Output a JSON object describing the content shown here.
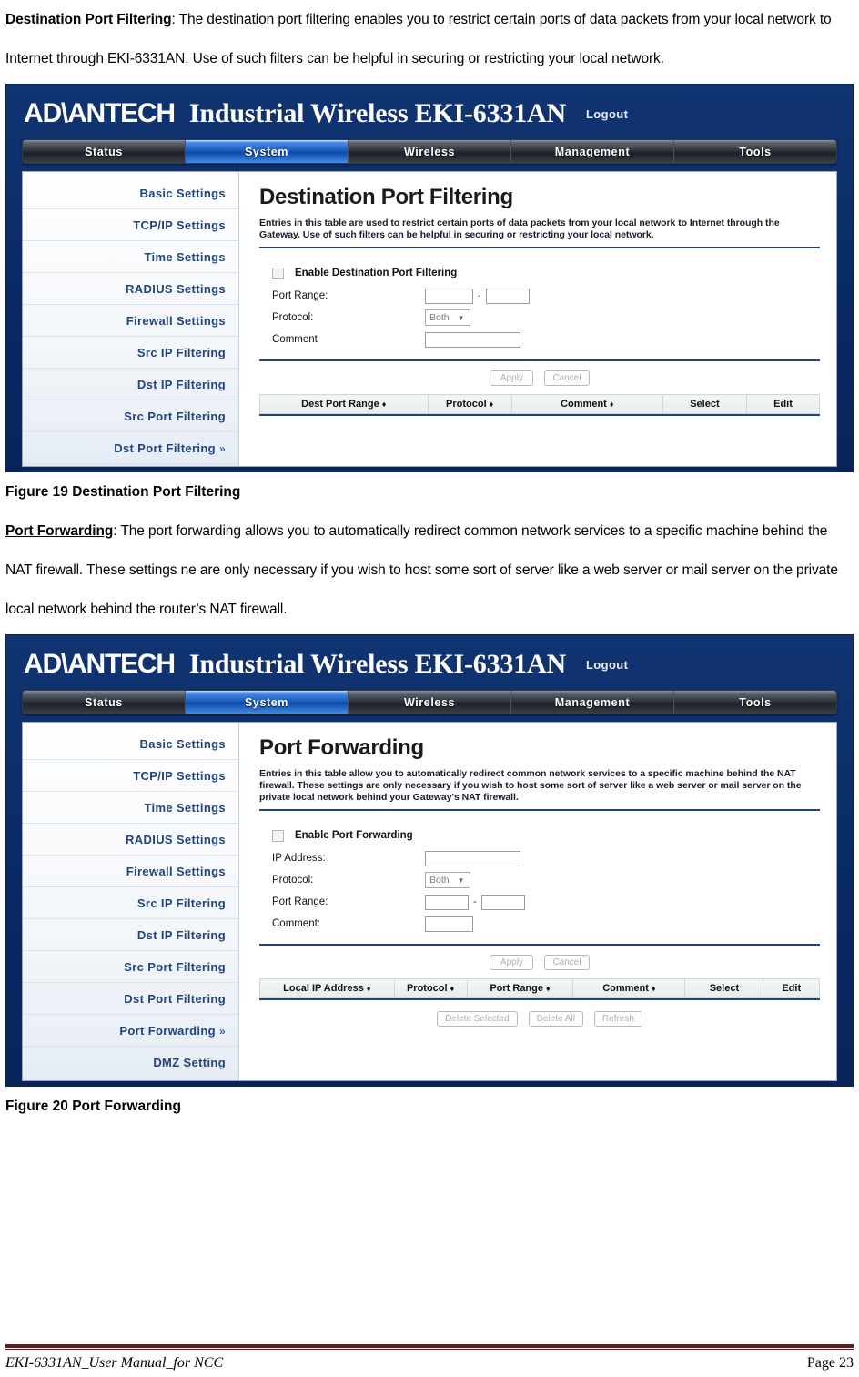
{
  "document": {
    "paragraph_1": {
      "lead": "Destination Port Filtering",
      "body": ": The destination port filtering enables you to restrict certain ports of data packets from your local network to Internet through EKI-6331AN. Use of such filters can be helpful in securing or restricting your local network."
    },
    "figure_19_caption": "Figure 19 Destination Port Filtering",
    "paragraph_2": {
      "lead": "Port Forwarding",
      "body": ": The port forwarding allows you to automatically redirect common network services to a specific machine behind the NAT firewall. These settings ne are only necessary if you wish to host some sort of server like a web server or mail server on the private local network behind the router’s NAT firewall."
    },
    "figure_20_caption": "Figure 20 Port Forwarding",
    "footer": {
      "left": "EKI-6331AN_User Manual_for NCC",
      "right": "Page 23"
    }
  },
  "colors": {
    "shell_blue": "#0d2f6b",
    "accent_blue": "#1456b8",
    "sidebar_text": "#21447f",
    "rule_navy": "#24447c",
    "footer_maroon": "#5c2020"
  },
  "screenshot_1": {
    "brand": {
      "logo": "AD\\ANTECH",
      "title": "Industrial Wireless EKI-6331AN",
      "logout": "Logout"
    },
    "tabs": [
      {
        "label": "Status",
        "active": false
      },
      {
        "label": "System",
        "active": true
      },
      {
        "label": "Wireless",
        "active": false
      },
      {
        "label": "Management",
        "active": false
      },
      {
        "label": "Tools",
        "active": false
      }
    ],
    "sidebar": [
      {
        "label": "Basic Settings",
        "selected": false
      },
      {
        "label": "TCP/IP Settings",
        "selected": false
      },
      {
        "label": "Time Settings",
        "selected": false
      },
      {
        "label": "RADIUS Settings",
        "selected": false
      },
      {
        "label": "Firewall Settings",
        "selected": false
      },
      {
        "label": "Src IP Filtering",
        "selected": false
      },
      {
        "label": "Dst IP Filtering",
        "selected": false
      },
      {
        "label": "Src Port Filtering",
        "selected": false
      },
      {
        "label": "Dst Port Filtering",
        "selected": true
      }
    ],
    "selected_marker": "»",
    "panel": {
      "title": "Destination Port Filtering",
      "description": "Entries in this table are used to restrict certain ports of data packets from your local network to Internet through the Gateway. Use of such filters can be helpful in securing or restricting your local network.",
      "checkbox_label": "Enable Destination Port Filtering",
      "checkbox_checked": false,
      "fields": {
        "port_range_label": "Port Range:",
        "port_range_from": "",
        "port_range_to": "",
        "port_range_separator": "-",
        "protocol_label": "Protocol:",
        "protocol_value": "Both",
        "comment_label": "Comment",
        "comment_value": ""
      },
      "buttons": [
        {
          "label": "Apply"
        },
        {
          "label": "Cancel"
        }
      ],
      "table_headers": [
        {
          "label": "Dest Port Range",
          "sortable": true
        },
        {
          "label": "Protocol",
          "sortable": true
        },
        {
          "label": "Comment",
          "sortable": true
        },
        {
          "label": "Select",
          "sortable": false
        },
        {
          "label": "Edit",
          "sortable": false
        }
      ],
      "sort_icon": "♦"
    }
  },
  "screenshot_2": {
    "brand": {
      "logo": "AD\\ANTECH",
      "title": "Industrial Wireless EKI-6331AN",
      "logout": "Logout"
    },
    "tabs": [
      {
        "label": "Status",
        "active": false
      },
      {
        "label": "System",
        "active": true
      },
      {
        "label": "Wireless",
        "active": false
      },
      {
        "label": "Management",
        "active": false
      },
      {
        "label": "Tools",
        "active": false
      }
    ],
    "sidebar": [
      {
        "label": "Basic Settings",
        "selected": false
      },
      {
        "label": "TCP/IP Settings",
        "selected": false
      },
      {
        "label": "Time Settings",
        "selected": false
      },
      {
        "label": "RADIUS Settings",
        "selected": false
      },
      {
        "label": "Firewall Settings",
        "selected": false
      },
      {
        "label": "Src IP Filtering",
        "selected": false
      },
      {
        "label": "Dst IP Filtering",
        "selected": false
      },
      {
        "label": "Src Port Filtering",
        "selected": false
      },
      {
        "label": "Dst Port Filtering",
        "selected": false
      },
      {
        "label": "Port Forwarding",
        "selected": true
      },
      {
        "label": "DMZ Setting",
        "selected": false
      }
    ],
    "selected_marker": "»",
    "panel": {
      "title": "Port Forwarding",
      "description": "Entries in this table allow you to automatically redirect common network services to a specific machine behind the NAT firewall. These settings are only necessary if you wish to host some sort of server like a web server or mail server on the private local network behind your Gateway's NAT firewall.",
      "checkbox_label": "Enable Port Forwarding",
      "checkbox_checked": false,
      "fields": {
        "ip_address_label": "IP Address:",
        "ip_address_value": "",
        "protocol_label": "Protocol:",
        "protocol_value": "Both",
        "port_range_label": "Port Range:",
        "port_range_from": "",
        "port_range_to": "",
        "port_range_separator": "-",
        "comment_label": "Comment:",
        "comment_value": ""
      },
      "buttons": [
        {
          "label": "Apply"
        },
        {
          "label": "Cancel"
        }
      ],
      "table_headers": [
        {
          "label": "Local IP Address",
          "sortable": true
        },
        {
          "label": "Protocol",
          "sortable": true
        },
        {
          "label": "Port Range",
          "sortable": true
        },
        {
          "label": "Comment",
          "sortable": true
        },
        {
          "label": "Select",
          "sortable": false
        },
        {
          "label": "Edit",
          "sortable": false
        }
      ],
      "sort_icon": "♦",
      "bottom_buttons": [
        {
          "label": "Delete Selected"
        },
        {
          "label": "Delete All"
        },
        {
          "label": "Refresh"
        }
      ]
    }
  }
}
